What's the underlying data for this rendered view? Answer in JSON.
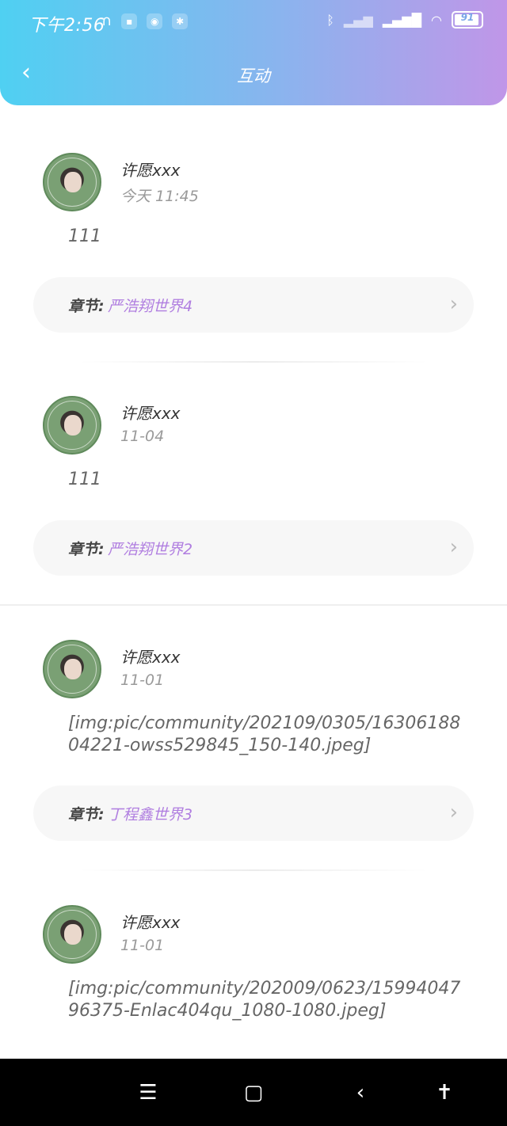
{
  "status_bar": {
    "time": "下午2:56",
    "battery": "91",
    "icons": [
      "headphones-icon",
      "app-icon",
      "app-icon",
      "app-icon",
      "bluetooth-icon",
      "signal-icon",
      "hd-signal-icon",
      "wifi-icon",
      "battery-icon"
    ]
  },
  "header": {
    "title": "互动",
    "back_icon": "chevron-left-icon"
  },
  "items": [
    {
      "username": "许愿xxx",
      "time": "今天  11:45",
      "content": "111",
      "chapter_label": "章节:",
      "chapter_name": "严浩翔世界4"
    },
    {
      "username": "许愿xxx",
      "time": "11-04",
      "content": "111",
      "chapter_label": "章节:",
      "chapter_name": "严浩翔世界2"
    },
    {
      "username": "许愿xxx",
      "time": "11-01",
      "content": "[img:pic/community/202109/0305/1630618804221-owss529845_150-140.jpeg]",
      "chapter_label": "章节:",
      "chapter_name": "丁程鑫世界3"
    },
    {
      "username": "许愿xxx",
      "time": "11-01",
      "content": "[img:pic/community/202009/0623/1599404796375-Enlac404qu_1080-1080.jpeg]"
    }
  ],
  "colors": {
    "accent": "#b07ee0",
    "header_start": "#4fd0f2",
    "header_end": "#c096e8"
  },
  "nav_bar": {
    "icons": [
      "menu-icon",
      "home-icon",
      "back-icon",
      "accessibility-icon"
    ]
  }
}
